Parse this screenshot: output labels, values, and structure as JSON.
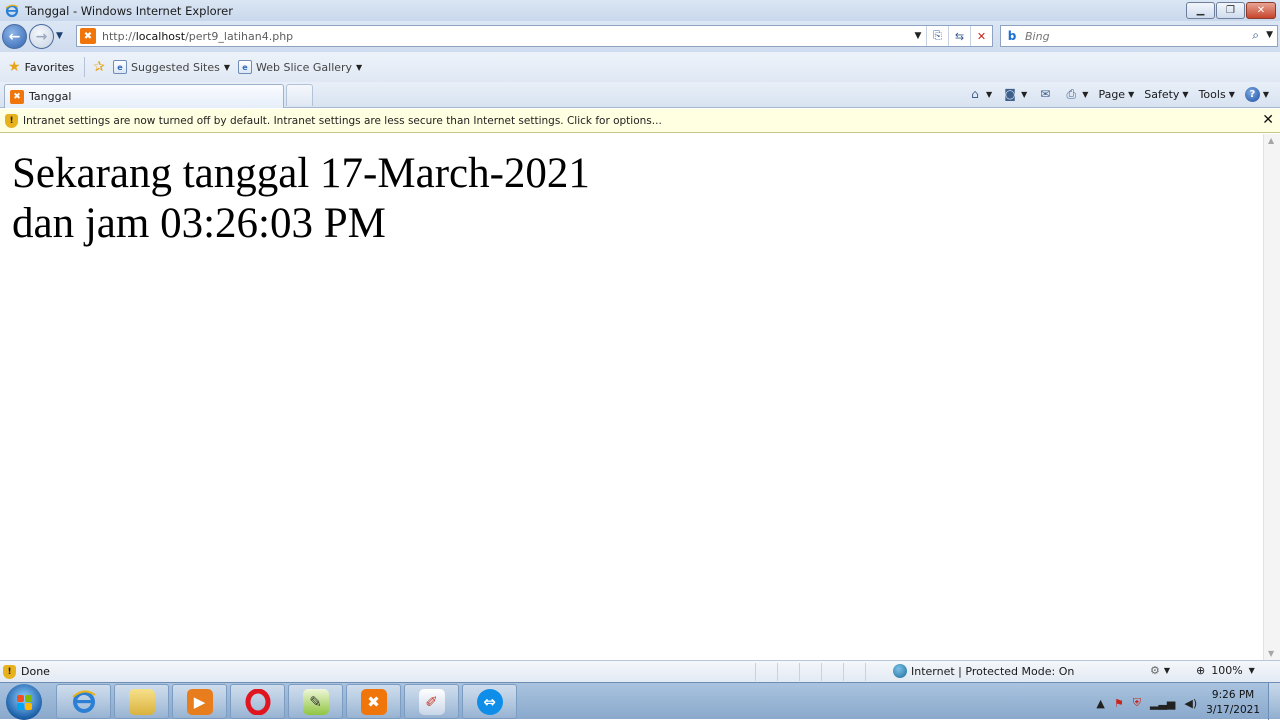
{
  "window": {
    "title": "Tanggal - Windows Internet Explorer"
  },
  "address": {
    "url_prefix": "http://",
    "url_host": "localhost",
    "url_path": "/pert9_latihan4.php"
  },
  "search": {
    "placeholder": "Bing"
  },
  "favorites_bar": {
    "favorites_label": "Favorites",
    "items": [
      {
        "label": "Suggested Sites"
      },
      {
        "label": "Web Slice Gallery"
      }
    ]
  },
  "tab": {
    "label": "Tanggal"
  },
  "command_bar": {
    "page_label": "Page",
    "safety_label": "Safety",
    "tools_label": "Tools"
  },
  "info_bar": {
    "message": "Intranet settings are now turned off by default. Intranet settings are less secure than Internet settings. Click for options..."
  },
  "content": {
    "line1": "Sekarang tanggal 17-March-2021",
    "line2": "dan jam 03:26:03 PM"
  },
  "status_bar": {
    "status": "Done",
    "zone": "Internet | Protected Mode: On",
    "zoom": "100%"
  },
  "taskbar": {
    "time": "9:26 PM",
    "date": "3/17/2021"
  },
  "colors": {
    "xampp": "#f0750a",
    "opera": "#e0151f",
    "teamviewer": "#0e8ee9"
  }
}
